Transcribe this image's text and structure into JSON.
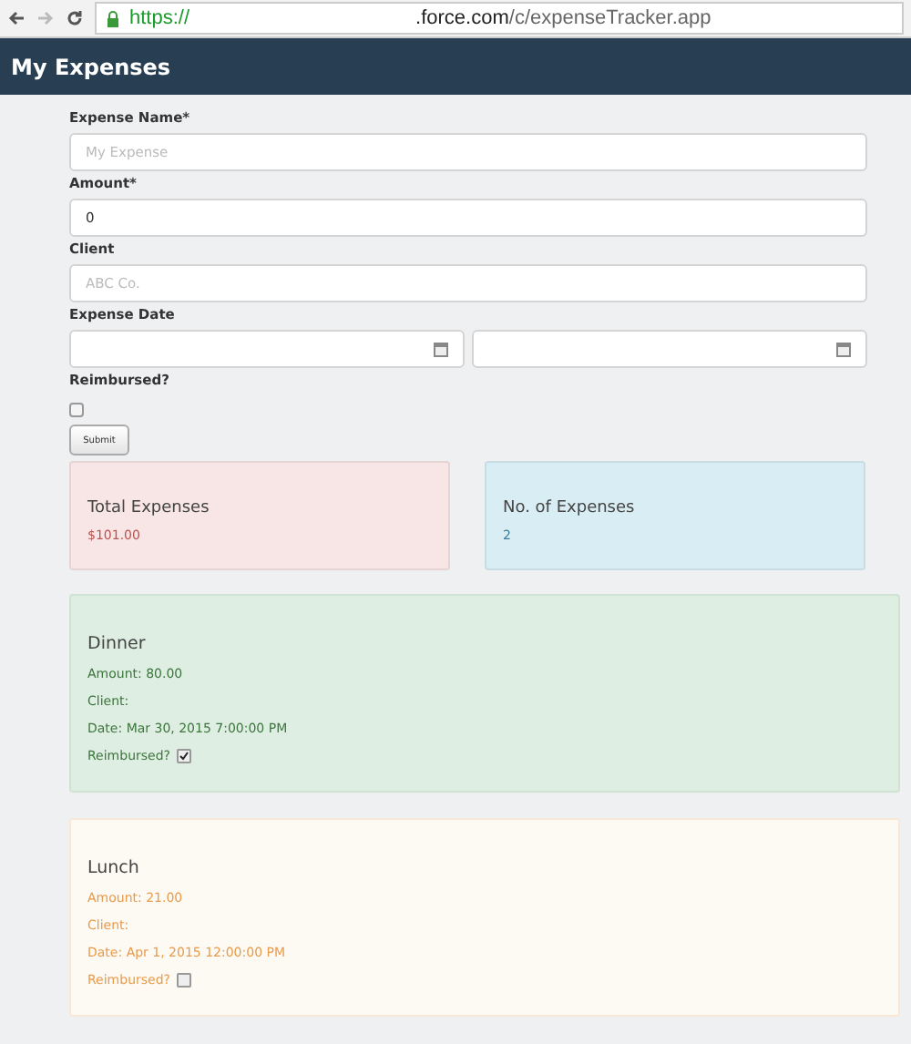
{
  "browser": {
    "url_scheme": "https://",
    "url_host": ".force.com",
    "url_path": "/c/expenseTracker.app"
  },
  "header": {
    "title": "My Expenses"
  },
  "form": {
    "fields": [
      {
        "kind": "text",
        "label": "Expense Name*",
        "placeholder": "My Expense"
      },
      {
        "kind": "text",
        "label": "Amount*",
        "value": "0"
      },
      {
        "kind": "text",
        "label": "Client",
        "placeholder": "ABC Co."
      },
      {
        "kind": "datetime",
        "label": "Expense Date"
      },
      {
        "kind": "checkbox",
        "label": "Reimbursed?",
        "checked": false
      }
    ],
    "submit": "Submit"
  },
  "stats": [
    {
      "title": "Total Expenses",
      "value": "$101.00",
      "color": "#f8e5e5"
    },
    {
      "title": "No. of Expenses",
      "value": "2",
      "color": "#d9edf4"
    }
  ],
  "expenses": [
    {
      "name": "Dinner",
      "amount": "Amount: 80.00",
      "client": "Client:",
      "date": "Date: Mar 30, 2015 7:00:00 PM",
      "reimbursed_label": "Reimbursed?",
      "reimbursed": true
    },
    {
      "name": "Lunch",
      "amount": "Amount: 21.00",
      "client": "Client:",
      "date": "Date: Apr 1, 2015 12:00:00 PM",
      "reimbursed_label": "Reimbursed?",
      "reimbursed": false
    }
  ]
}
